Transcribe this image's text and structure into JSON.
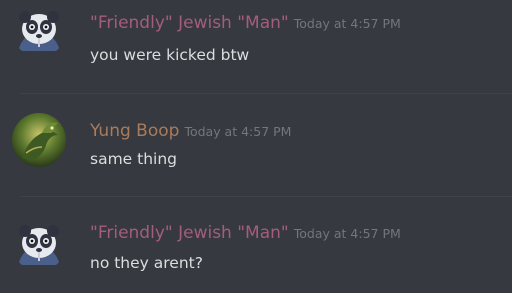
{
  "messages": [
    {
      "username": "\"Friendly\" Jewish \"Man\"",
      "timestamp": "Today at 4:57 PM",
      "text": "you were kicked btw",
      "avatar_icon": "panda-face-avatar",
      "name_color": "#a45c81"
    },
    {
      "username": "Yung Boop",
      "timestamp": "Today at 4:57 PM",
      "text": "same thing",
      "avatar_icon": "green-dragon-avatar",
      "name_color": "#a87c5c"
    },
    {
      "username": "\"Friendly\" Jewish \"Man\"",
      "timestamp": "Today at 4:57 PM",
      "text": "no they arent?",
      "avatar_icon": "panda-face-avatar",
      "name_color": "#a45c81"
    }
  ],
  "colors": {
    "background": "#36393f",
    "divider": "#3f4248",
    "text": "#dcddde",
    "timestamp": "#72767d"
  }
}
